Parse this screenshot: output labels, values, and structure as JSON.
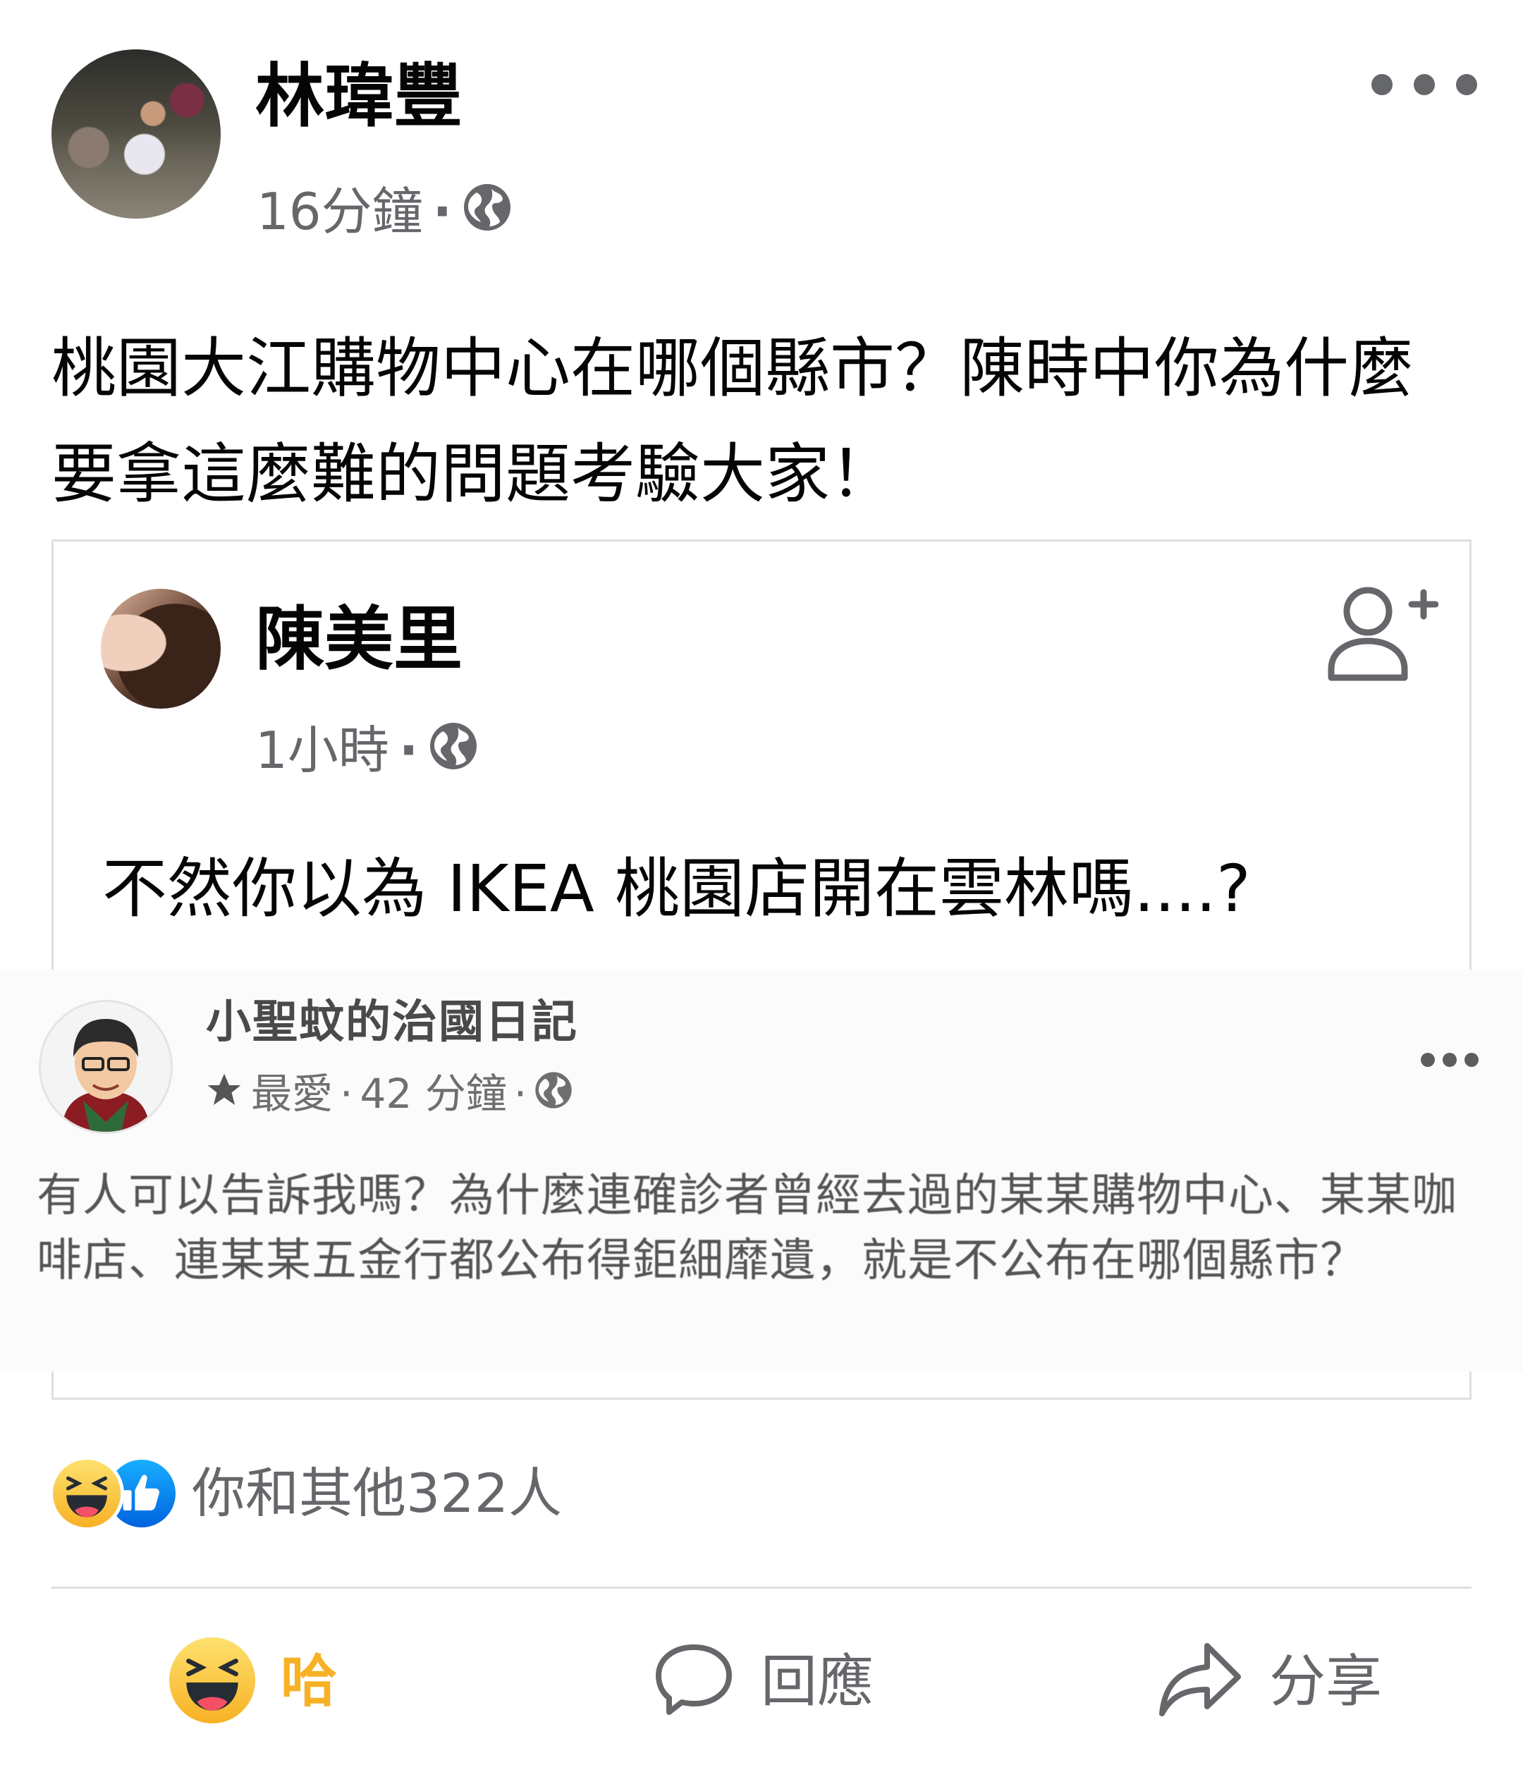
{
  "post": {
    "author": "林瑋豐",
    "time": "16分鐘",
    "separator": "·",
    "text": "桃園大江購物中心在哪個縣市？陳時中你為什麼要拿這麼難的問題考驗大家！"
  },
  "shared_post": {
    "author": "陳美里",
    "time": "1小時",
    "separator": "·",
    "text": "不然你以為 IKEA 桃園店開在雲林嗎....?"
  },
  "embedded_post": {
    "page_name": "小聖蚊的治國日記",
    "badge": "最愛",
    "time": "42 分鐘",
    "separator": "·",
    "text": "有人可以告訴我嗎？為什麼連確診者曾經去過的某某購物中心、某某咖啡店、連某某五金行都公布得鉅細靡遺，就是不公布在哪個縣市？"
  },
  "reactions": {
    "count_text": "你和其他322人",
    "icons": [
      "haha-icon",
      "like-icon"
    ]
  },
  "actions": {
    "haha_label": "哈",
    "comment_label": "回應",
    "share_label": "分享"
  },
  "colors": {
    "text_primary": "#050505",
    "text_secondary": "#65676b",
    "haha": "#f7b125",
    "like": "#1877f2",
    "divider": "#dddfe2"
  }
}
